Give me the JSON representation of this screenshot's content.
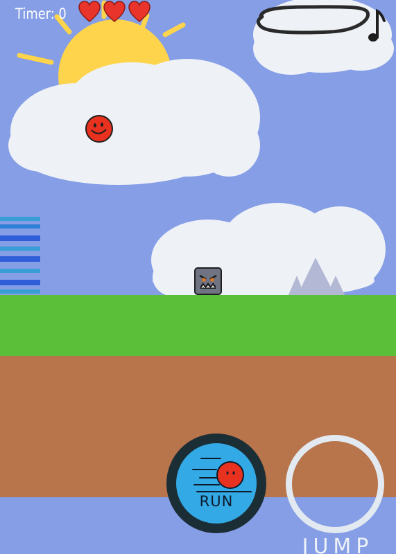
{
  "hud": {
    "timer_text": "Timer: 0",
    "lives": 3
  },
  "controls": {
    "run_label": "RUN",
    "jump_label": "JUMP"
  },
  "colors": {
    "sky": "#859ee6",
    "grass": "#5bbf3a",
    "dirt": "#b8744a",
    "cloud": "#eef1f6",
    "sun": "#fdd44b",
    "player": "#e8321f",
    "run_button": "#33a9e6",
    "enemy": "#6f7382",
    "spikes": "#b3b9d4"
  },
  "icons": {
    "hud": [
      "heart-icon",
      "music-note-icon"
    ],
    "player": "red-ball-face",
    "enemy": "angry-block-face"
  }
}
